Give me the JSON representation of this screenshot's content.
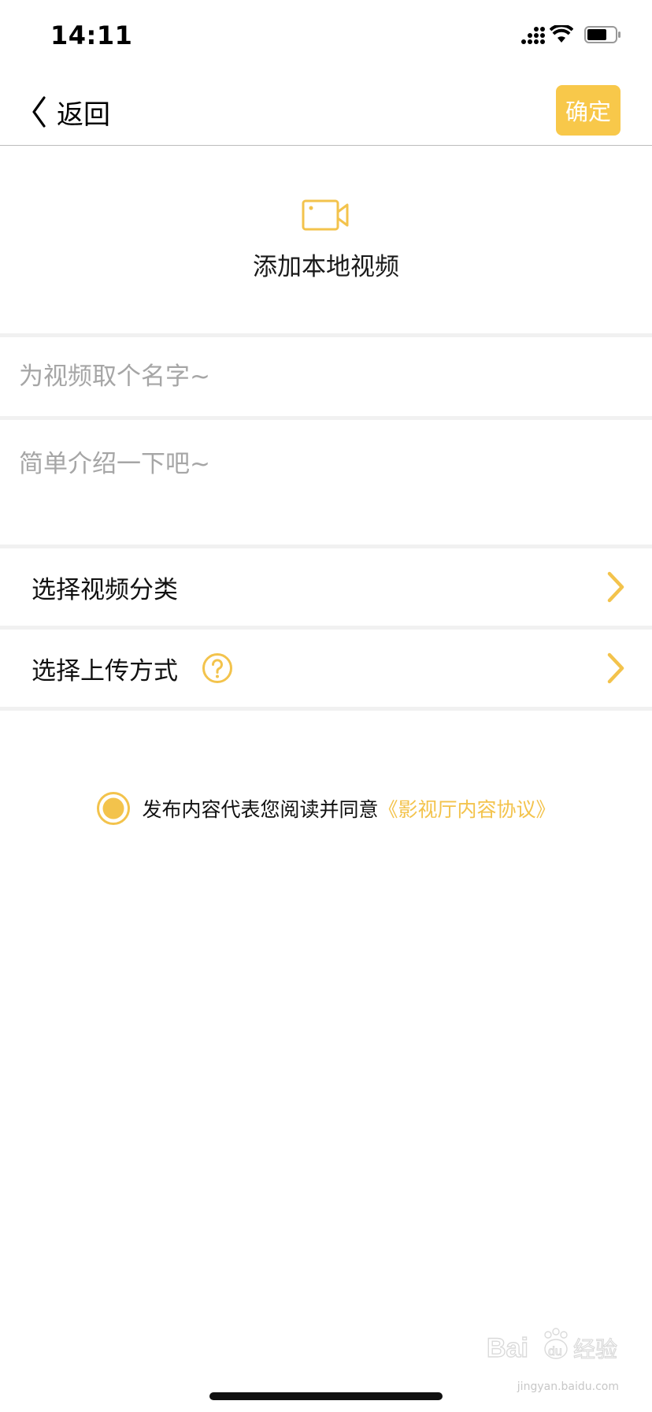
{
  "status_bar": {
    "time": "14:11",
    "icons": [
      "cellular-signal-icon",
      "wifi-icon",
      "battery-icon"
    ]
  },
  "nav": {
    "back_label": "返回",
    "confirm_label": "确定"
  },
  "add_video": {
    "label": "添加本地视频",
    "icon": "video-camera-icon"
  },
  "form": {
    "title_placeholder": "为视频取个名字~",
    "title_value": "",
    "description_placeholder": "简单介绍一下吧~",
    "description_value": ""
  },
  "rows": {
    "category_label": "选择视频分类",
    "upload_method_label": "选择上传方式"
  },
  "agreement": {
    "checked": true,
    "text": "发布内容代表您阅读并同意",
    "link": "《影视厅内容协议》"
  },
  "watermark": {
    "brand": "Baidu 经验",
    "url": "jingyan.baidu.com"
  },
  "colors": {
    "accent": "#f8c84a",
    "link": "#f3c34c",
    "placeholder": "#a6a6a6",
    "divider": "#f1f1f1"
  }
}
